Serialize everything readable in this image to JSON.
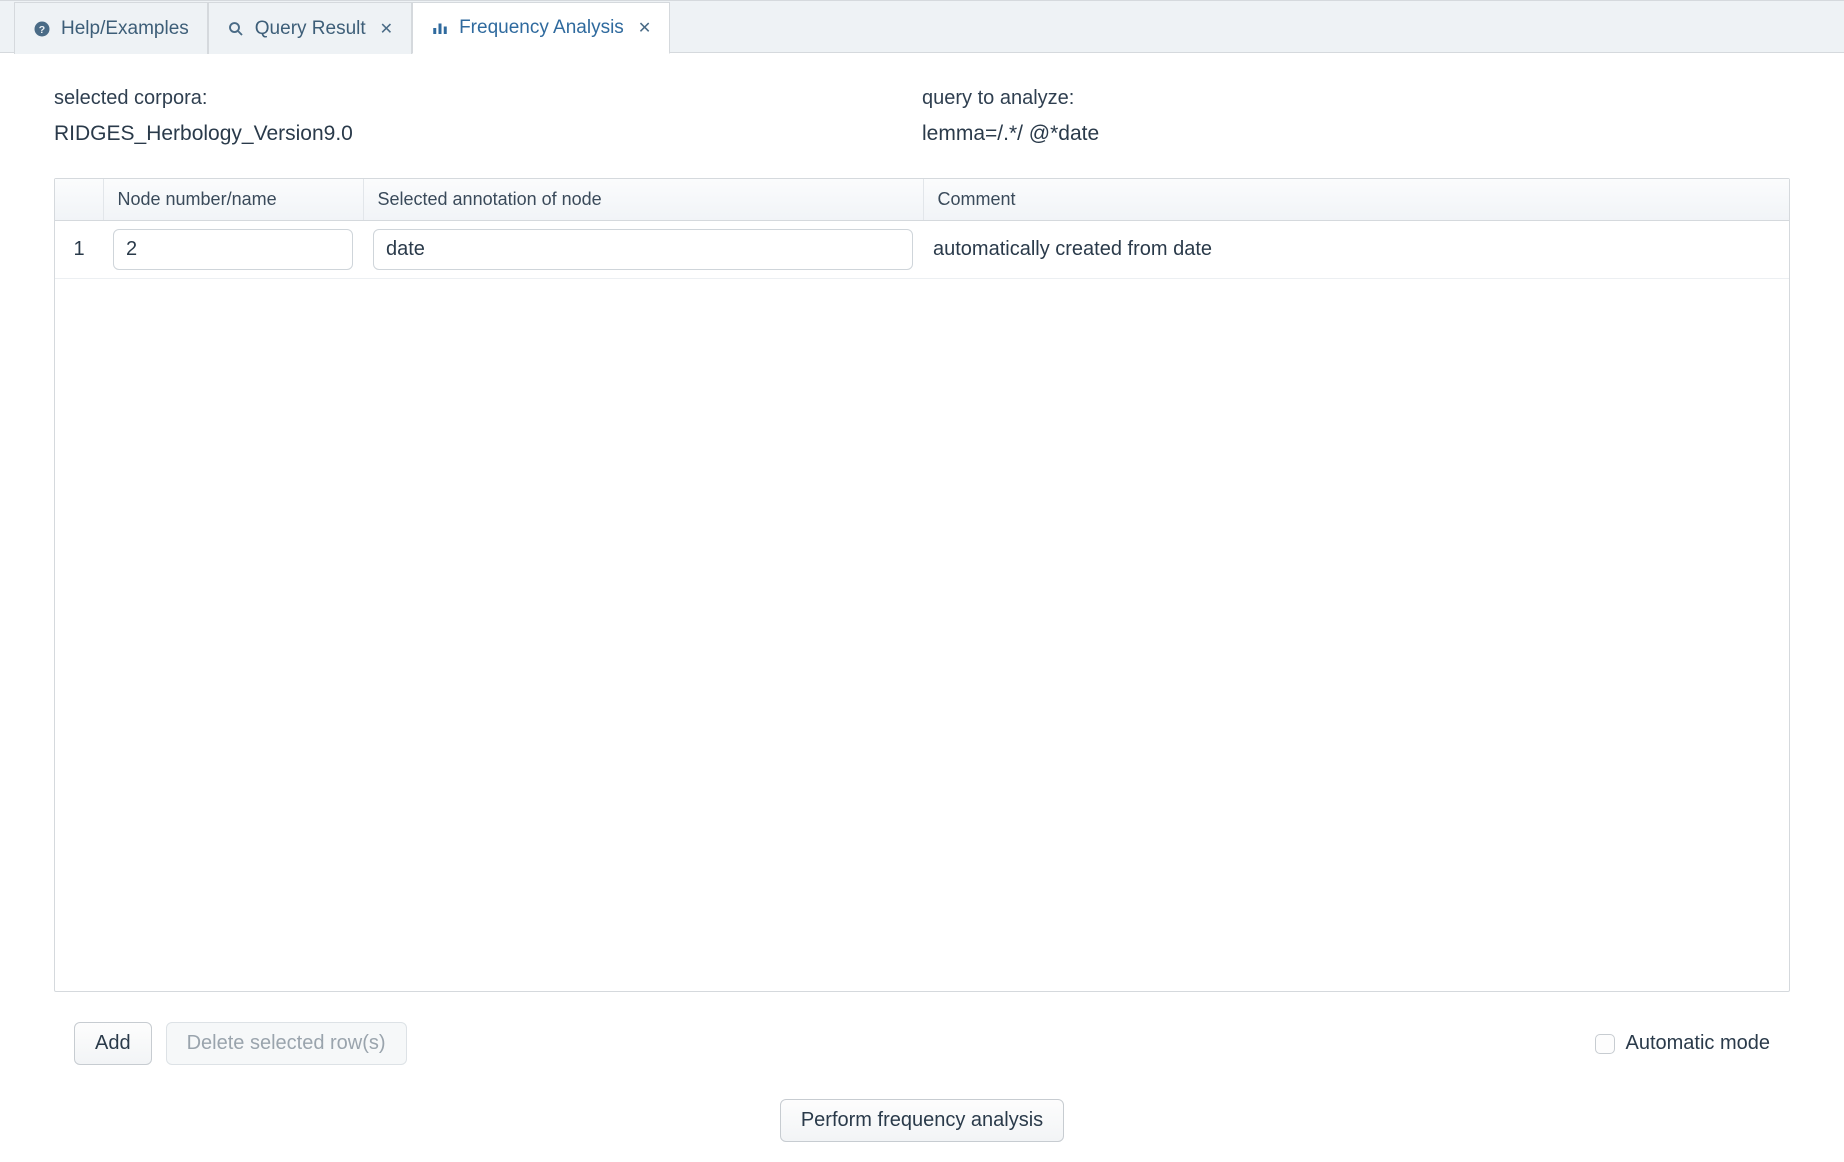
{
  "tabs": [
    {
      "label": "Help/Examples",
      "icon": "help",
      "closable": false,
      "active": false
    },
    {
      "label": "Query Result",
      "icon": "search",
      "closable": true,
      "active": false
    },
    {
      "label": "Frequency Analysis",
      "icon": "bars",
      "closable": true,
      "active": true
    }
  ],
  "meta": {
    "corpora_label": "selected corpora:",
    "corpora_value": "RIDGES_Herbology_Version9.0",
    "query_label": "query to analyze:",
    "query_value": "lemma=/.*/ @*date"
  },
  "table": {
    "headers": {
      "index": "",
      "node": "Node number/name",
      "annotation": "Selected annotation of node",
      "comment": "Comment"
    },
    "rows": [
      {
        "index": "1",
        "node": "2",
        "annotation": "date",
        "comment": "automatically created from date"
      }
    ]
  },
  "buttons": {
    "add": "Add",
    "delete": "Delete selected row(s)",
    "perform": "Perform frequency analysis"
  },
  "automatic": {
    "label": "Automatic mode",
    "checked": false
  }
}
